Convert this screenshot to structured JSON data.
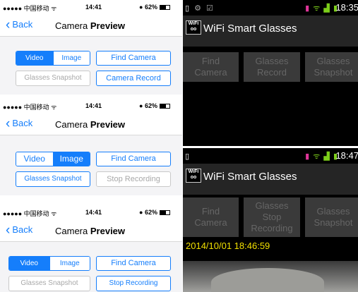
{
  "ios": {
    "status": {
      "signal": "●●●●● 中国移动 ᯤ",
      "time": "14:41",
      "battery": "62%"
    },
    "nav": {
      "back": "Back",
      "title_plain": "Camera",
      "title_bold": "Preview"
    },
    "screens": [
      {
        "seg_video": "Video",
        "seg_image": "Image",
        "selected": "Video",
        "find": "Find Camera",
        "snapshot": "Glasses Snapshot",
        "snapshot_disabled": true,
        "record": "Camera Record",
        "record_disabled": false
      },
      {
        "seg_video": "Video",
        "seg_image": "Image",
        "selected": "Image",
        "find": "Find Camera",
        "snapshot": "Glasses Snapshot",
        "snapshot_disabled": false,
        "record": "Stop Recording",
        "record_disabled": true
      },
      {
        "seg_video": "Video",
        "seg_image": "Image",
        "selected": "Video",
        "find": "Find Camera",
        "snapshot": "Glasses Snapshot",
        "snapshot_disabled": true,
        "record": "Stop Recording",
        "record_disabled": false
      }
    ]
  },
  "android": [
    {
      "time": "18:35",
      "logo": "WiFi",
      "title": "WiFi Smart Glasses",
      "buttons": [
        "Find\nCamera",
        "Glasses\nRecord",
        "Glasses\nSnapshot"
      ]
    },
    {
      "time": "18:47",
      "logo": "WiFi",
      "title": "WiFi Smart Glasses",
      "buttons": [
        "Find\nCamera",
        "Glasses\nStop\nRecording",
        "Glasses\nSnapshot"
      ],
      "timestamp": "2014/10/01 18:46:59"
    }
  ],
  "colors": {
    "ios_accent": "#157efb",
    "android_bg": "#000000",
    "timestamp": "#f2e000"
  }
}
